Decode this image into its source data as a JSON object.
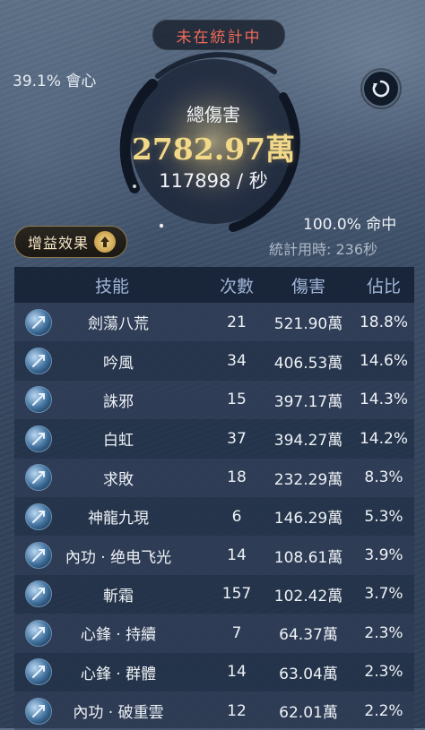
{
  "status": "未在統計中",
  "crit_rate": "39.1% 會心",
  "total": {
    "label": "總傷害",
    "value": "2782.97萬",
    "dps": "117898 / 秒"
  },
  "hit_rate": "100.0% 命中",
  "duration": "統計用時: 236秒",
  "buff_button": "增益效果",
  "table": {
    "headers": [
      "技能",
      "次數",
      "傷害",
      "佔比"
    ],
    "rows": [
      {
        "skill": "劍蕩八荒",
        "count": "21",
        "damage": "521.90萬",
        "pct": "18.8%",
        "icon": "sword-icon"
      },
      {
        "skill": "吟風",
        "count": "34",
        "damage": "406.53萬",
        "pct": "14.6%",
        "icon": "wind-icon"
      },
      {
        "skill": "誅邪",
        "count": "15",
        "damage": "397.17萬",
        "pct": "14.3%",
        "icon": "blade-icon"
      },
      {
        "skill": "白虹",
        "count": "37",
        "damage": "394.27萬",
        "pct": "14.2%",
        "icon": "rainbow-icon"
      },
      {
        "skill": "求敗",
        "count": "18",
        "damage": "232.29萬",
        "pct": "8.3%",
        "icon": "sword-icon"
      },
      {
        "skill": "神龍九現",
        "count": "6",
        "damage": "146.29萬",
        "pct": "5.3%",
        "icon": "dragon-icon"
      },
      {
        "skill": "內功 · 绝电飞光",
        "count": "14",
        "damage": "108.61萬",
        "pct": "3.9%",
        "icon": "lightning-icon"
      },
      {
        "skill": "斬霜",
        "count": "157",
        "damage": "102.42萬",
        "pct": "3.7%",
        "icon": "frost-icon"
      },
      {
        "skill": "心鋒 · 持續",
        "count": "7",
        "damage": "64.37萬",
        "pct": "2.3%",
        "icon": "heart-blade-icon"
      },
      {
        "skill": "心鋒 · 群體",
        "count": "14",
        "damage": "63.04萬",
        "pct": "2.3%",
        "icon": "heart-blade-icon"
      },
      {
        "skill": "內功 · 破重雲",
        "count": "12",
        "damage": "62.01萬",
        "pct": "2.2%",
        "icon": "cloud-icon"
      }
    ]
  },
  "colors": {
    "status_red": "#f06a5a",
    "damage_gold": "#f2d98a",
    "header_blue": "#9fb5d6"
  }
}
